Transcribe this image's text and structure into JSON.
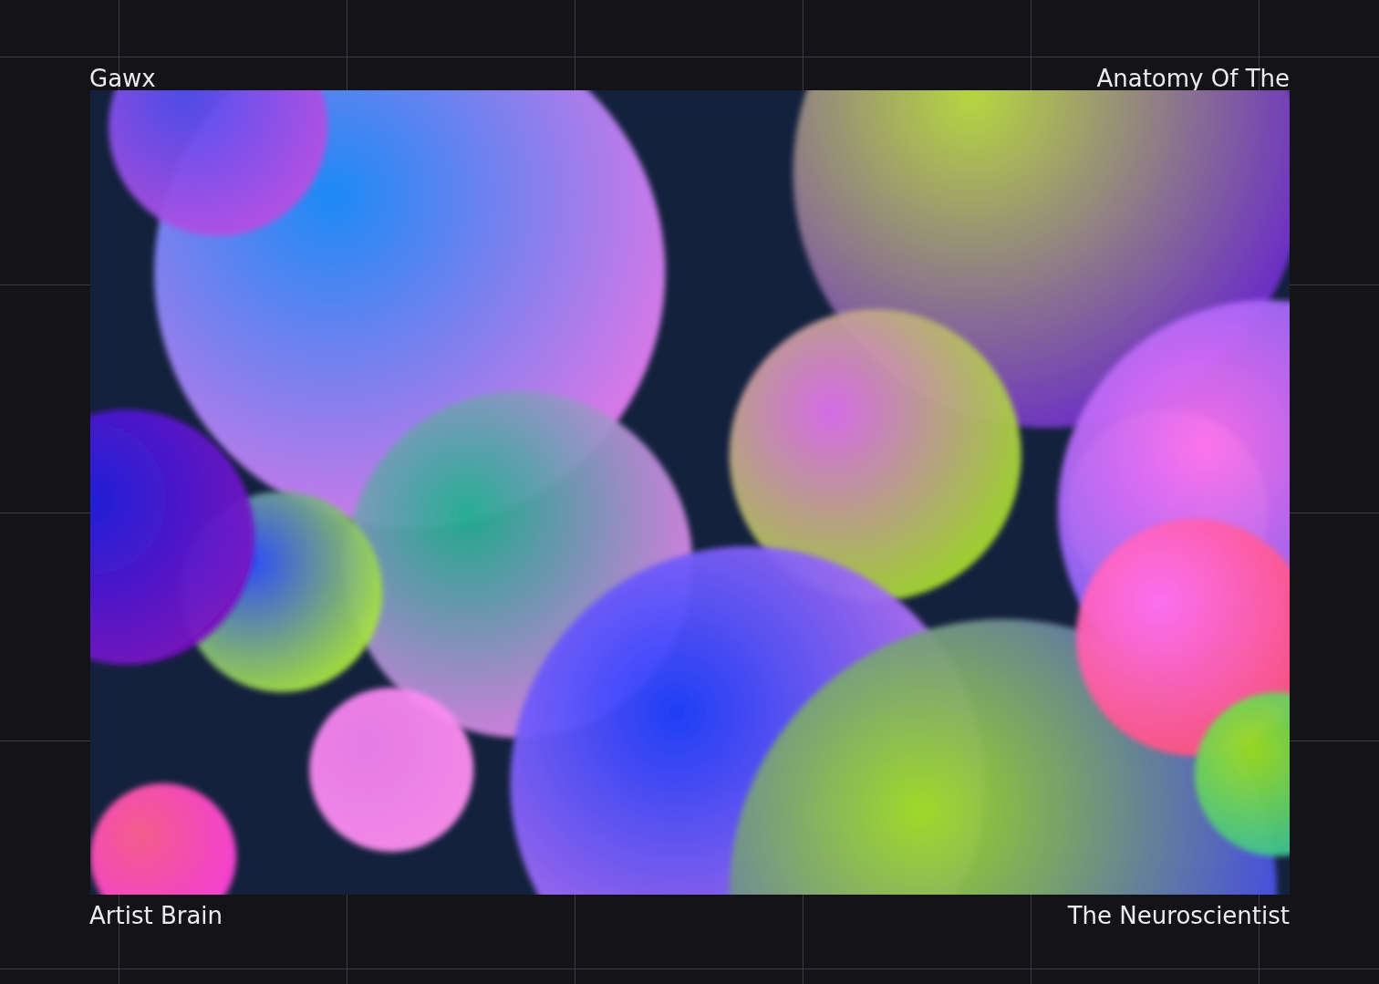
{
  "captions": {
    "top_left": "Gawx",
    "top_right": "Anatomy Of The",
    "bottom_left": "Artist Brain",
    "bottom_right": "The Neuroscientist"
  }
}
